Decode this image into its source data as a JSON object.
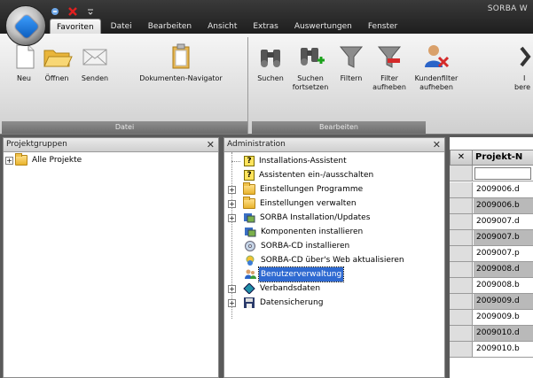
{
  "window": {
    "title": "SORBA W",
    "colors": {
      "accent": "#2f6ad1",
      "titlebar": "#262626",
      "ribbon": "#e2e2e2"
    }
  },
  "qat": {
    "icons": [
      "arrow-icon",
      "close-red-icon",
      "dropdown-icon"
    ]
  },
  "tabs": [
    {
      "label": "Favoriten",
      "active": true
    },
    {
      "label": "Datei"
    },
    {
      "label": "Bearbeiten"
    },
    {
      "label": "Ansicht"
    },
    {
      "label": "Extras"
    },
    {
      "label": "Auswertungen"
    },
    {
      "label": "Fenster"
    }
  ],
  "ribbon": {
    "groups": [
      {
        "label": "Datei",
        "buttons": [
          {
            "label": "Neu",
            "icon": "new-document-icon"
          },
          {
            "label": "Öffnen",
            "icon": "folder-open-icon"
          },
          {
            "label": "Senden",
            "icon": "envelope-icon"
          },
          {
            "label": "Dokumenten-Navigator",
            "icon": "clipboard-icon"
          }
        ]
      },
      {
        "label": "Bearbeiten",
        "buttons": [
          {
            "label": "Suchen",
            "icon": "binoculars-icon"
          },
          {
            "label": "Suchen",
            "label2": "fortsetzen",
            "icon": "binoculars-plus-icon"
          },
          {
            "label": "Filtern",
            "icon": "funnel-icon"
          },
          {
            "label": "Filter",
            "label2": "aufheben",
            "icon": "funnel-remove-icon"
          },
          {
            "label": "Kundenfilter",
            "label2": "aufheben",
            "icon": "user-remove-icon"
          },
          {
            "label": "I",
            "label2": "bere",
            "icon": "partial-icon"
          }
        ]
      }
    ]
  },
  "panes": {
    "projects": {
      "title": "Projektgruppen",
      "items": [
        {
          "label": "Alle Projekte"
        }
      ]
    },
    "admin": {
      "title": "Administration",
      "items": [
        {
          "label": "Installations-Assistent",
          "icon": "help-icon"
        },
        {
          "label": "Assistenten ein-/ausschalten",
          "icon": "help-icon"
        },
        {
          "label": "Einstellungen Programme",
          "icon": "folder-icon",
          "expander": "+"
        },
        {
          "label": "Einstellungen verwalten",
          "icon": "folder-icon",
          "expander": "+"
        },
        {
          "label": "SORBA Installation/Updates",
          "icon": "install-icon",
          "expander": "+"
        },
        {
          "label": "Komponenten installieren",
          "icon": "install-icon"
        },
        {
          "label": "SORBA-CD installieren",
          "icon": "cd-icon"
        },
        {
          "label": "SORBA-CD über's Web aktualisieren",
          "icon": "web-cd-icon"
        },
        {
          "label": "Benutzerverwaltung",
          "icon": "users-icon",
          "selected": true
        },
        {
          "label": "Verbandsdaten",
          "icon": "diamond-icon",
          "expander": "+"
        },
        {
          "label": "Datensicherung",
          "icon": "floppy-icon",
          "expander": "+"
        }
      ]
    },
    "grid": {
      "corner": "✕",
      "column": "Projekt-N",
      "rows": [
        "2009006.d",
        "2009006.b",
        "2009007.d",
        "2009007.b",
        "2009007.p",
        "2009008.d",
        "2009008.b",
        "2009009.d",
        "2009009.b",
        "2009010.d",
        "2009010.b"
      ]
    }
  }
}
